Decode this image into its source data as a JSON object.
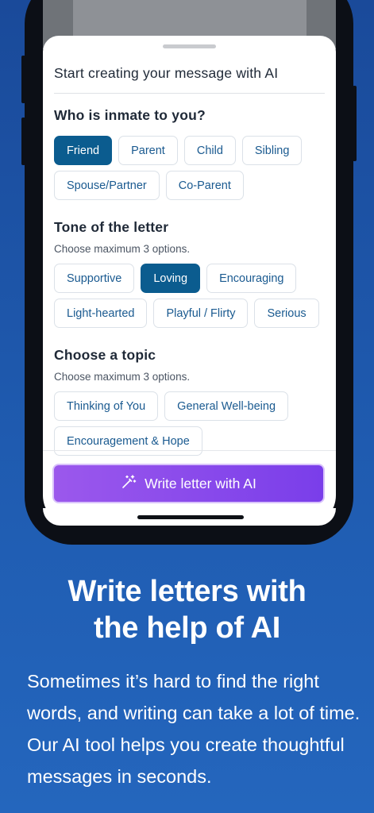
{
  "sheet": {
    "title": "Start creating your message with AI"
  },
  "relationship": {
    "title": "Who is inmate to you?",
    "options": [
      {
        "label": "Friend",
        "selected": true
      },
      {
        "label": "Parent",
        "selected": false
      },
      {
        "label": "Child",
        "selected": false
      },
      {
        "label": "Sibling",
        "selected": false
      },
      {
        "label": "Spouse/Partner",
        "selected": false
      },
      {
        "label": "Co-Parent",
        "selected": false
      }
    ]
  },
  "tone": {
    "title": "Tone of the letter",
    "subtitle": "Choose maximum 3 options.",
    "options": [
      {
        "label": "Supportive",
        "selected": false
      },
      {
        "label": "Loving",
        "selected": true
      },
      {
        "label": "Encouraging",
        "selected": false
      },
      {
        "label": "Light-hearted",
        "selected": false
      },
      {
        "label": "Playful / Flirty",
        "selected": false
      },
      {
        "label": "Serious",
        "selected": false
      }
    ]
  },
  "topic": {
    "title": "Choose a topic",
    "subtitle": "Choose maximum 3 options.",
    "options": [
      {
        "label": "Thinking of You",
        "selected": false
      },
      {
        "label": "General Well-being",
        "selected": false
      },
      {
        "label": "Encouragement & Hope",
        "selected": false
      }
    ]
  },
  "cta": {
    "label": "Write letter with AI",
    "icon": "magic-wand-icon"
  },
  "promo": {
    "headline_line1": "Write letters with",
    "headline_line2": "the help of AI",
    "body": "Sometimes it’s hard to find the right words, and writing can take a lot of time. Our AI tool helps you create thoughtful messages in seconds."
  },
  "colors": {
    "background": "#1f5bb0",
    "chip_selected": "#0b5c8f",
    "chip_text": "#1a5a90",
    "cta_start": "#9b58ec",
    "cta_end": "#7a3eea"
  }
}
